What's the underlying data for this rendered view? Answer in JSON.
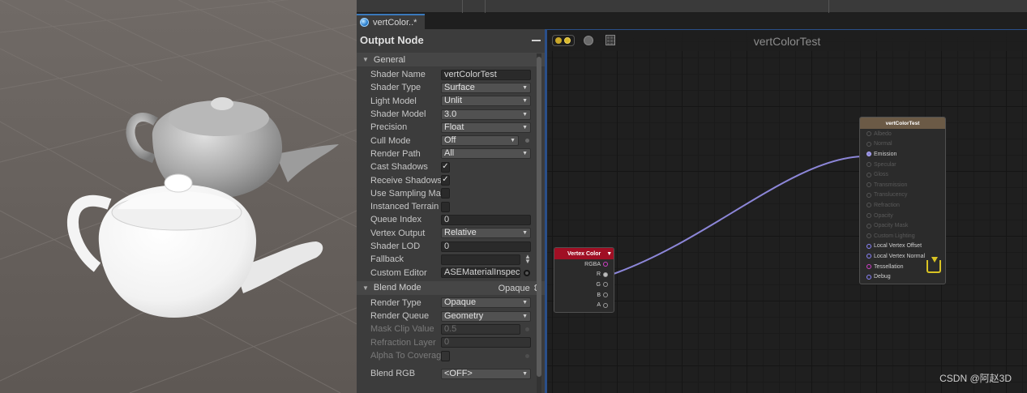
{
  "editor_tab": {
    "title": "vertColor..*"
  },
  "panel": {
    "title": "Output Node",
    "sections": {
      "general": {
        "label": "General"
      },
      "blend": {
        "label": "Blend Mode",
        "value": "Opaque"
      }
    },
    "general_rows": {
      "shader_name": {
        "label": "Shader Name",
        "value": "vertColorTest"
      },
      "shader_type": {
        "label": "Shader Type",
        "value": "Surface"
      },
      "light_model": {
        "label": "Light Model",
        "value": "Unlit"
      },
      "shader_model": {
        "label": "Shader Model",
        "value": "3.0"
      },
      "precision": {
        "label": "Precision",
        "value": "Float"
      },
      "cull_mode": {
        "label": "Cull Mode",
        "value": "Off"
      },
      "render_path": {
        "label": "Render Path",
        "value": "All"
      },
      "cast_shadows": {
        "label": "Cast Shadows",
        "checked": "✓"
      },
      "receive_shadows": {
        "label": "Receive Shadows",
        "checked": "✓"
      },
      "use_sampling_macros": {
        "label": "Use Sampling Mac"
      },
      "instanced_terrain": {
        "label": "Instanced Terrain"
      },
      "queue_index": {
        "label": "Queue Index",
        "value": "0"
      },
      "vertex_output": {
        "label": "Vertex Output",
        "value": "Relative"
      },
      "shader_lod": {
        "label": "Shader LOD",
        "value": "0"
      },
      "fallback": {
        "label": "Fallback",
        "value": ""
      },
      "custom_editor": {
        "label": "Custom Editor",
        "value": "ASEMaterialInspecto"
      }
    },
    "blend_rows": {
      "render_type": {
        "label": "Render Type",
        "value": "Opaque"
      },
      "render_queue": {
        "label": "Render Queue",
        "value": "Geometry"
      },
      "mask_clip_value": {
        "label": "Mask Clip Value",
        "value": "0.5"
      },
      "refraction_layer": {
        "label": "Refraction Layer",
        "value": "0"
      },
      "alpha_to_coverage": {
        "label": "Alpha To Coverage"
      },
      "blend_rgb": {
        "label": "Blend RGB",
        "value": "<OFF>"
      }
    }
  },
  "canvas": {
    "title": "vertColorTest",
    "vertex_color_node": {
      "title": "Vertex Color",
      "ports": [
        "RGBA",
        "R",
        "G",
        "B",
        "A"
      ]
    },
    "output_node": {
      "title": "vertColorTest",
      "ports": [
        "Albedo",
        "Normal",
        "Emission",
        "Specular",
        "Gloss",
        "Transmission",
        "Translucency",
        "Refraction",
        "Opacity",
        "Opacity Mask",
        "Custom Lighting",
        "Local Vertex Offset",
        "Local Vertex Normal",
        "Tessellation",
        "Debug"
      ]
    }
  },
  "watermark": "CSDN @阿赵3D",
  "colors": {
    "accent_blue": "#3a79bb",
    "vertex_color_header": "#a00f24",
    "output_header": "#6b5a46",
    "wire": "#8c86d8",
    "save_icon": "#d9c323"
  }
}
